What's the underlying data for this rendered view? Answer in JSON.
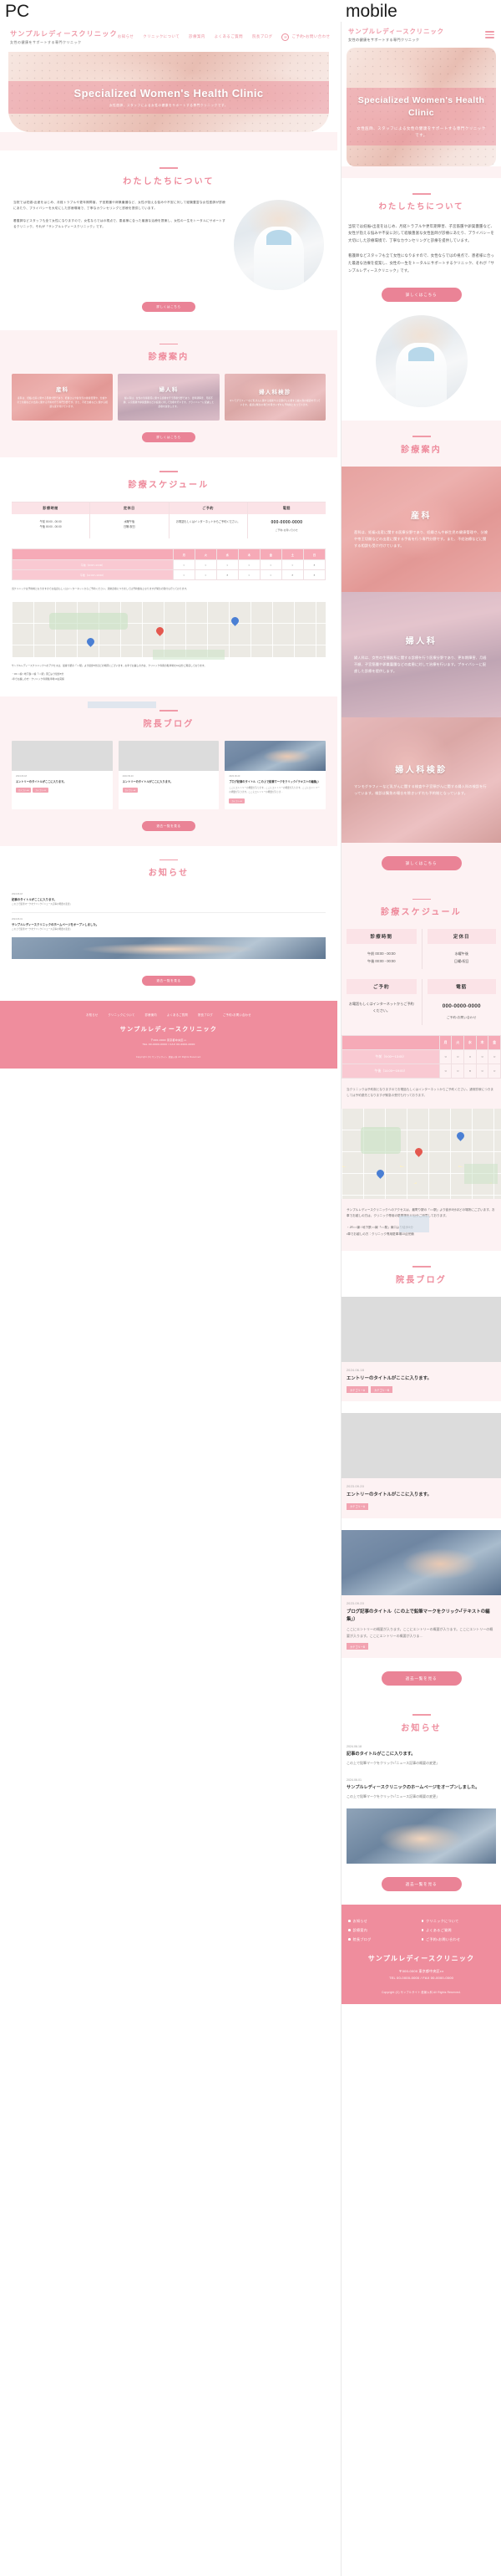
{
  "labels": {
    "pc": "PC",
    "mobile": "mobile"
  },
  "brand": {
    "name": "サンプルレディースクリニック",
    "tagline": "女性の健康をサポートする専門クリニック"
  },
  "nav": {
    "items": [
      {
        "label": "お知らせ"
      },
      {
        "label": "クリニックについて"
      },
      {
        "label": "診療案内"
      },
      {
        "label": "よくあるご質問"
      },
      {
        "label": "院長ブログ"
      }
    ],
    "cta": {
      "icon": "mail-icon",
      "label": "ご予約・お問い合わせ"
    },
    "menu_icon": "hamburger-menu-icon"
  },
  "hero": {
    "title": "Specialized Women's Health Clinic",
    "subtitle": "女性医師、スタッフによる女性の健康をサポートする専門クリニックです。",
    "image": "pregnant-belly-hands-photo"
  },
  "about": {
    "title": "わたしたちについて",
    "paragraphs": [
      "当院では妊娠・出産をはじめ、月経トラブルや更年期障害、子宮筋腫や卵巣嚢腫など、女性が抱える悩みや不安に対して経験豊富な女性医師が診療にあたり、プライバシーを大切にした診療環境で、丁寧なカウンセリングと診療を提供しています。",
      "看護師などスタッフも全て女性になりますので、女性ならではの視点で、患者様に合った最適な治療を提案し、女性の一生をトータルにサポートするクリニック、それが「サンプルレディースクリニック」です。"
    ],
    "button": "詳しくはこちら",
    "image": "female-doctor-stethoscope-photo"
  },
  "services": {
    "title": "診療案内",
    "button": "詳しくはこちら",
    "cards": [
      {
        "name": "産科",
        "text": "産科は、妊娠・出産に関する医療分野であり、妊婦さんや新生児の健康管理や、分娩や帝王切開などの出産に関する手術を行う専門分野です。また、不妊治療などに関する相談も受け付けています。",
        "image": "pregnant-heart-hands-photo"
      },
      {
        "name": "婦人科",
        "text": "婦人科は、女性の生殖器系に関する診療を行う医療分野であり、更年期障害、月経不順、子宮筋腫や卵巣嚢腫などの疾患に対して治療を行います。プライバシーに配慮した診療を提供します。",
        "image": "clinic-reception-photo"
      },
      {
        "name": "婦人科検診",
        "text": "マンモグラフィーなど乳がんに関する検査や子宮頸がんに関する婦人科の検診を行っています。検診は緊急の場合を除きいずれも予約制となっています。",
        "image": "woman-with-tablet-photo"
      }
    ]
  },
  "schedule": {
    "title": "診療スケジュール",
    "cells": [
      {
        "head": "診療時間",
        "lines": [
          "午前 00:00 - 00:00",
          "午後 00:00 - 00:00"
        ]
      },
      {
        "head": "定休日",
        "lines": [
          "水曜午後",
          "日曜・祝日"
        ]
      },
      {
        "head": "ご予約",
        "lines": [
          "お電話もしくはインターネットからご予約ください。"
        ]
      },
      {
        "head": "電話",
        "lines": [
          "000-0000-0000"
        ],
        "sub": "ご予約・お問い合わせ"
      }
    ],
    "calendar": {
      "days": [
        "月",
        "火",
        "水",
        "木",
        "金",
        "土",
        "日"
      ],
      "rows": [
        {
          "label": "午前（9:00〜13:00）",
          "marks": [
            "○",
            "○",
            "○",
            "○",
            "○",
            "○",
            "×"
          ]
        },
        {
          "label": "午後（14:00〜19:00）",
          "marks": [
            "○",
            "○",
            "×",
            "○",
            "○",
            "×",
            "×"
          ]
        }
      ]
    },
    "note": "当クリニックは予約制となりますのでお電話もしくはインターネットからご予約ください。通常診療につきましては予約優先となりますが緊急の受付も行っております。"
  },
  "access": {
    "map_label": "サンプルレディースクリニック",
    "lines": [
      "サンプルレディースクリニックへのアクセスは、最寄り駅の「○○駅」より徒歩5分ほどの場所にございます。お車でお越しの方は、クリニック専用の駐車場を10台分ご用意しております。",
      "・JR○○線 / 地下鉄○○線「○○駅」東口より徒歩5分",
      "・車でお越しの方：クリニック専用駐車場10台完備"
    ]
  },
  "blog": {
    "title": "院長ブログ",
    "button": "過去一覧を見る",
    "posts": [
      {
        "date": "2024.06.18",
        "title": "エントリーのタイトルがここに入ります。",
        "excerpt": "",
        "tags": [
          "カテゴリーA",
          "カテゴリーB"
        ],
        "image": "placeholder-grey"
      },
      {
        "date": "2023.09.20",
        "title": "エントリーのタイトルがここに入ります。",
        "excerpt": "",
        "tags": [
          "カテゴリーA"
        ],
        "image": "placeholder-grey"
      },
      {
        "date": "2023.09.20",
        "title": "ブログ記事のタイトル（この上で鉛筆マークをクリック・「テキストの編集」）",
        "excerpt": "ここにエントリーの概要が入ります。ここにエントリーの概要が入ります。ここにエントリーの概要が入ります。ここにエントリーの概要が入りま…",
        "tags": [
          "カテゴリーB"
        ],
        "image": "sleeping-baby-photo"
      }
    ]
  },
  "news": {
    "title": "お知らせ",
    "button": "過去一覧を見る",
    "items": [
      {
        "date": "2024.06.18",
        "title": "記事のタイトルがここに入ります。",
        "excerpt": "この上で鉛筆マークをクリック・「ニュース記事の概要の変更」"
      },
      {
        "date": "2024.06.01",
        "title": "サンプルレディースクリニックのホームページをオープンしました。",
        "excerpt": "この上で鉛筆マークをクリック・「ニュース記事の概要の変更」",
        "image": "newborn-baby-photo"
      }
    ]
  },
  "footer": {
    "links": [
      "お知らせ",
      "クリニックについて",
      "診療案内",
      "よくあるご質問",
      "院長ブログ",
      "ご予約・お問い合わせ"
    ],
    "brand": "サンプルレディースクリニック",
    "address": "〒000-0000 東京都中央区・・・",
    "tel": "TEL 00-0000-0000 / FAX 00-0000-0000",
    "copyright": "Copyright (C) サンプルサイト 産婦人科 All Rights Reserved."
  },
  "colors": {
    "accent": "#ef8d9d",
    "accent_dark": "#ea8396",
    "soft_bg": "#fdf2f3",
    "table_head": "#f6aab7"
  }
}
